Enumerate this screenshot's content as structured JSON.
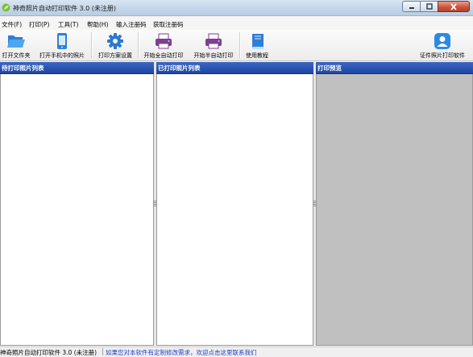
{
  "window": {
    "title": "神奇照片自动打印软件 3.0 (未注册)",
    "icon": "app-leaf-icon"
  },
  "menu": {
    "items": [
      {
        "label": "文件(F)"
      },
      {
        "label": "打印(P)"
      },
      {
        "label": "工具(T)"
      },
      {
        "label": "帮助(H)"
      },
      {
        "label": "输入注册码"
      },
      {
        "label": "获取注册码"
      }
    ]
  },
  "toolbar": {
    "buttons": [
      {
        "label": "打开文件夹",
        "icon": "folder-open-icon"
      },
      {
        "label": "打开手机中的照片",
        "icon": "mobile-phone-icon"
      },
      {
        "label": "打印方案设置",
        "icon": "gear-icon"
      },
      {
        "label": "开始全自动打印",
        "icon": "printer-icon"
      },
      {
        "label": "开始半自动打印",
        "icon": "printer-icon"
      },
      {
        "label": "使用教程",
        "icon": "book-icon"
      },
      {
        "label": "证件照片打印软件",
        "icon": "user-id-icon"
      }
    ]
  },
  "panes": {
    "pending_title": "待打印照片列表",
    "printed_title": "已打印照片列表",
    "preview_title": "打印预览"
  },
  "status": {
    "app_info": "神奇照片自动打印软件 3.0 (未注册)",
    "link": "如果您对本软件有定制修改需求，欢迎点击这里联系我们"
  },
  "colors": {
    "pane_header": "#2a52b0",
    "preview_bg": "#c0c0c0",
    "link": "#1a3fc9",
    "close_button": "#c9503a"
  }
}
